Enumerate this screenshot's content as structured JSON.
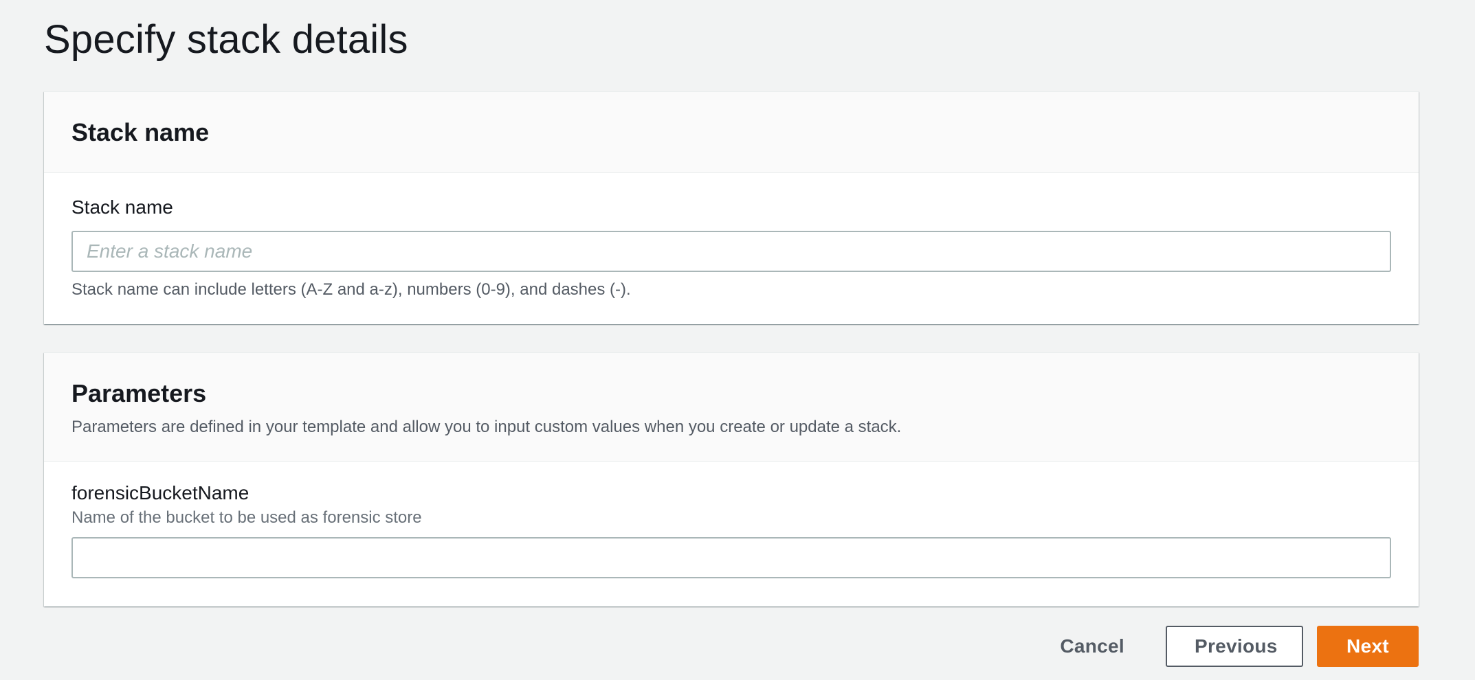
{
  "page": {
    "title": "Specify stack details"
  },
  "stack_name_section": {
    "title": "Stack name",
    "field_label": "Stack name",
    "placeholder": "Enter a stack name",
    "value": "",
    "hint": "Stack name can include letters (A-Z and a-z), numbers (0-9), and dashes (-)."
  },
  "parameters_section": {
    "title": "Parameters",
    "description": "Parameters are defined in your template and allow you to input custom values when you create or update a stack.",
    "parameters": [
      {
        "name": "forensicBucketName",
        "description": "Name of the bucket to be used as forensic store",
        "value": ""
      }
    ]
  },
  "footer": {
    "cancel_label": "Cancel",
    "previous_label": "Previous",
    "next_label": "Next"
  },
  "colors": {
    "background": "#f2f3f3",
    "primary_button": "#ec7211",
    "text": "#16191f",
    "secondary_text": "#545b64",
    "input_border": "#aab7b8"
  }
}
